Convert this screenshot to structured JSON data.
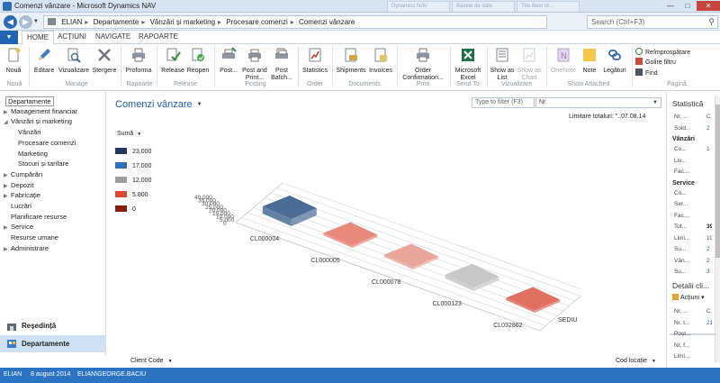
{
  "window": {
    "title": "Comenzi vânzare - Microsoft Dynamics NAV",
    "ghost_tabs": [
      "Dynamics NAV",
      "Bazele de date",
      "The Best of…"
    ],
    "minimize": "—",
    "maximize": "□",
    "close": "✕"
  },
  "address": {
    "breadcrumb": [
      "ELIAN",
      "Departamente",
      "Vânzări și marketing",
      "Procesare comenzi",
      "Comenzi vânzare"
    ],
    "search_placeholder": "Search (Ctrl+F3)"
  },
  "ribbon_tabs": {
    "app_menu": "▼",
    "tabs": [
      "HOME",
      "ACȚIUNI",
      "NAVIGATE",
      "RAPOARTE"
    ]
  },
  "ribbon": {
    "buttons": {
      "noua": "Nouă",
      "editare": "Editare",
      "vizualizare": "Vizualizare",
      "stergere": "Ștergere",
      "proforma": "Proforma",
      "release": "Release",
      "reopen": "Reopen",
      "post": "Post...",
      "post_print": "Post and Print...",
      "post_batch": "Post Batch...",
      "statistics": "Statistics",
      "shipments": "Shipments",
      "invoices": "Invoices",
      "order_conf": "Order Confirmation...",
      "excel": "Microsoft Excel",
      "show_list": "Show as List",
      "show_chart": "Show as Chart",
      "onenote": "OneNote",
      "note": "Note",
      "legaturi": "Legături",
      "reimprospatare": "Reîmprospătare",
      "golire_filtru": "Golire filtru",
      "find": "Find"
    },
    "groups": {
      "noua": "Nouă",
      "manage": "Manage",
      "rapoarte": "Rapoarte",
      "release": "Release",
      "posting": "Posting",
      "order": "Order",
      "documents": "Documents",
      "print": "Print",
      "send_to": "Send To",
      "vizualizare": "Vizualizare",
      "show_attached": "Show Attached",
      "pagina": "Pagină"
    }
  },
  "leftnav": {
    "items": [
      {
        "label": "Departamente",
        "level": 0,
        "arrow": ""
      },
      {
        "label": "Management financiar",
        "level": 0,
        "arrow": "▶"
      },
      {
        "label": "Vânzări și marketing",
        "level": 0,
        "arrow": "◢"
      },
      {
        "label": "Vânzări",
        "level": 1,
        "arrow": ""
      },
      {
        "label": "Procesare comenzi",
        "level": 1,
        "arrow": ""
      },
      {
        "label": "Marketing",
        "level": 1,
        "arrow": ""
      },
      {
        "label": "Stocuri și tarifare",
        "level": 1,
        "arrow": ""
      },
      {
        "label": "Cumpărări",
        "level": 0,
        "arrow": "▶"
      },
      {
        "label": "Depozit",
        "level": 0,
        "arrow": "▶"
      },
      {
        "label": "Fabricație",
        "level": 0,
        "arrow": "▶"
      },
      {
        "label": "Lucrări",
        "level": 0,
        "arrow": ""
      },
      {
        "label": "Planificare resurse",
        "level": 0,
        "arrow": ""
      },
      {
        "label": "Service",
        "level": 0,
        "arrow": "▶"
      },
      {
        "label": "Resurse umane",
        "level": 0,
        "arrow": ""
      },
      {
        "label": "Administrare",
        "level": 0,
        "arrow": "▶"
      }
    ],
    "bottom": {
      "resedinta": "Reședință",
      "departamente": "Departamente"
    }
  },
  "main": {
    "title": "Comenzi vânzare",
    "filter_placeholder": "Type to filter (F3)",
    "filter_field": "Nr.",
    "limit_label": "Limitare totaluri: \"..07.08.14",
    "legend_title": "Sumă",
    "legend": [
      {
        "label": "23.000",
        "color": "#1f3a5c"
      },
      {
        "label": "17.000",
        "color": "#2e6fbb"
      },
      {
        "label": "12.000",
        "color": "#9e9e9e"
      },
      {
        "label": "5.800",
        "color": "#e0462f"
      },
      {
        "label": "0",
        "color": "#8a1c10"
      }
    ],
    "bottom_left": "Client Code",
    "bottom_right": "Cod locație"
  },
  "chart_data": {
    "type": "bar",
    "categories": [
      "CL000004",
      "CL000005",
      "CL000078",
      "CL000123",
      "CL032862"
    ],
    "depth_label": "SEDIU",
    "series": [
      {
        "name": "SEDIU",
        "values": [
          23000,
          5800,
          5800,
          12000,
          5800
        ]
      }
    ],
    "colors": [
      "#4a6c95",
      "#e78a7c",
      "#e9a59a",
      "#c8c8c8",
      "#e07060"
    ],
    "y_ticks": [
      "40.000",
      "35.000",
      "30.000",
      "25.000",
      "20.000",
      "15.000",
      "10.000",
      "5.000",
      "0"
    ],
    "ylim": [
      0,
      40000
    ]
  },
  "factbox": {
    "stat_title": "Statistică",
    "stat_rows": [
      {
        "label": "Nr. ...",
        "value": "C"
      },
      {
        "label": "Sold...",
        "value": "2"
      }
    ],
    "vanzari_head": "Vânzări",
    "vanzari_rows": [
      {
        "label": "Co...",
        "value": "1"
      },
      {
        "label": "Liv...",
        "value": ""
      },
      {
        "label": "Fac...",
        "value": ""
      }
    ],
    "service_head": "Service",
    "service_rows": [
      {
        "label": "Co...",
        "value": ""
      },
      {
        "label": "Ser...",
        "value": ""
      },
      {
        "label": "Fac...",
        "value": ""
      },
      {
        "label": "Tot...",
        "value": "39"
      },
      {
        "label": "Limi...",
        "value": "10"
      },
      {
        "label": "Su...",
        "value": "2"
      },
      {
        "label": "Vân...",
        "value": "2"
      },
      {
        "label": "Su...",
        "value": "3"
      }
    ],
    "detail_title": "Detalii cli...",
    "actions": "Acțiuni",
    "detail_rows": [
      {
        "label": "Nr. ...",
        "value": "C"
      },
      {
        "label": "Nr. t...",
        "value": "21"
      },
      {
        "label": "Poșt...",
        "value": ""
      },
      {
        "label": "Nr. f...",
        "value": ""
      },
      {
        "label": "Limi...",
        "value": ""
      }
    ]
  },
  "status": {
    "company": "ELIAN",
    "date": "8 august 2014",
    "user": "ELIAN\\GEORGE.BACIU"
  }
}
